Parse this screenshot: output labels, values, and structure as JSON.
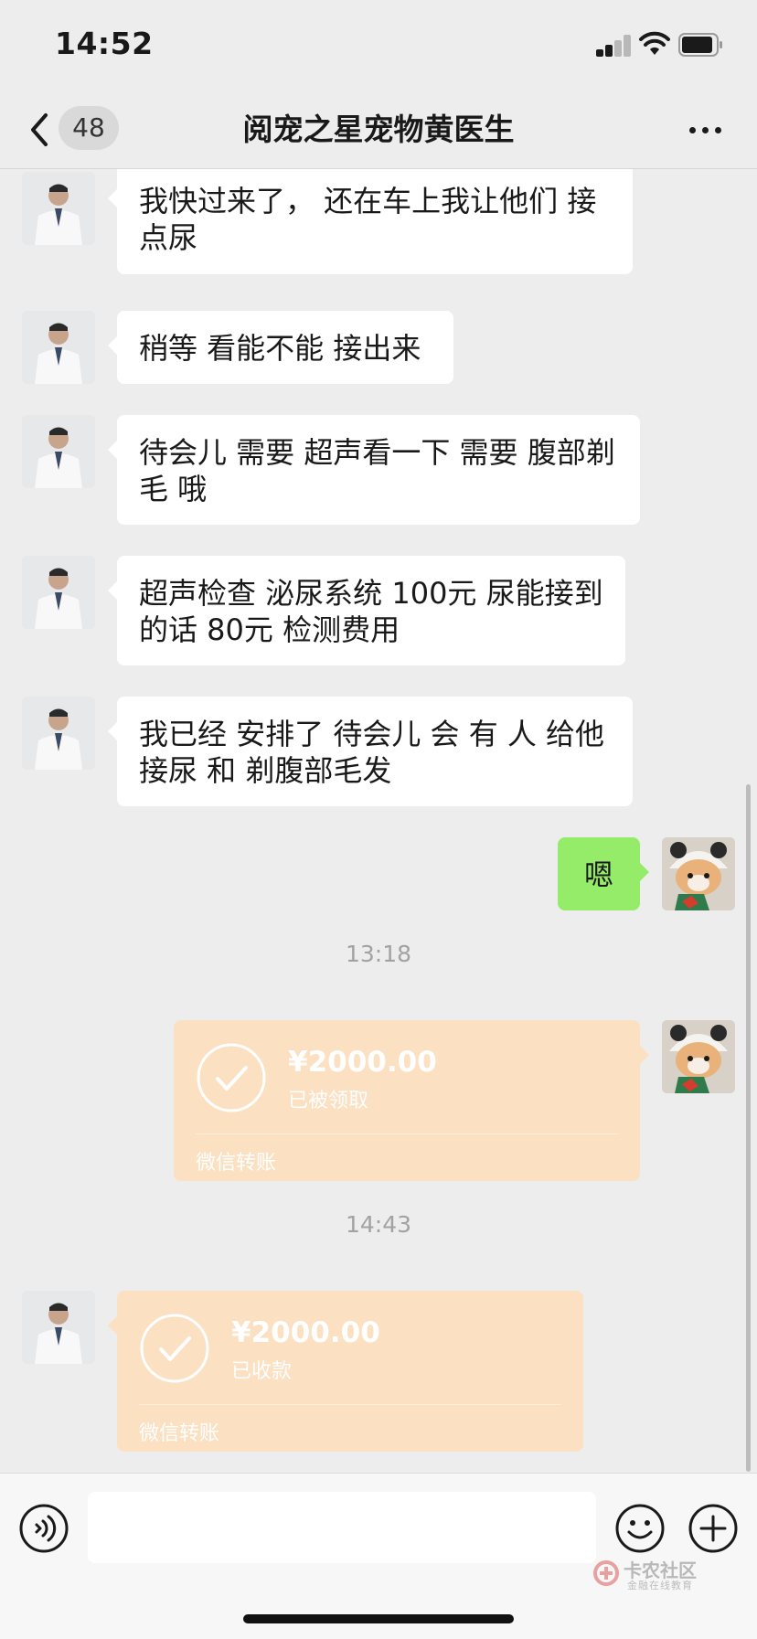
{
  "status_bar": {
    "time": "14:52"
  },
  "nav": {
    "unread_count": "48",
    "title": "阅宠之星宠物黄医生"
  },
  "messages": [
    {
      "text": "我快过来了， 还在车上我让他们 接点尿"
    },
    {
      "text": "稍等 看能不能 接出来"
    },
    {
      "text": "待会儿 需要 超声看一下 需要 腹部剃毛 哦"
    },
    {
      "text": "超声检查 泌尿系统 100元 尿能接到的话 80元 检测费用"
    },
    {
      "text": "我已经 安排了 待会儿 会 有 人  给他接尿 和 剃腹部毛发"
    },
    {
      "text": "嗯"
    }
  ],
  "timestamps": [
    "13:18",
    "14:43"
  ],
  "transfers": [
    {
      "amount": "¥2000.00",
      "status": "已被领取",
      "brand": "微信转账"
    },
    {
      "amount": "¥2000.00",
      "status": "已收款",
      "brand": "微信转账"
    }
  ],
  "watermark": {
    "title": "卡农社区",
    "subtitle": "金融在线教育"
  },
  "colors": {
    "background": "#ededed",
    "sent_bubble": "#95ec69",
    "received_bubble": "#ffffff",
    "transfer_card": "#fbe0c2"
  }
}
